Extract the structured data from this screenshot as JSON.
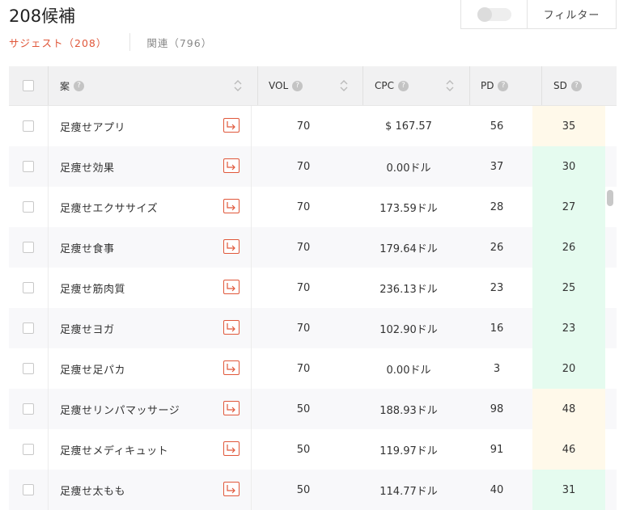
{
  "header": {
    "title": "208候補"
  },
  "tabs": {
    "suggest": "サジェスト（208）",
    "related": "関連（796）"
  },
  "filter": {
    "label": "フィルター"
  },
  "columns": {
    "keyword": "案",
    "vol": "VOL",
    "cpc": "CPC",
    "pd": "PD",
    "sd": "SD",
    "help": "?"
  },
  "colors": {
    "accent": "#e0573a",
    "sd_green": "#e5fbef",
    "sd_yellow": "#fff9ea"
  },
  "rows": [
    {
      "keyword": "足痩せアプリ",
      "vol": "70",
      "cpc": "$ 167.57",
      "pd": "56",
      "sd": "35",
      "sd_level": "yellow"
    },
    {
      "keyword": "足痩せ効果",
      "vol": "70",
      "cpc": "0.00ドル",
      "pd": "37",
      "sd": "30",
      "sd_level": "green"
    },
    {
      "keyword": "足痩せエクササイズ",
      "vol": "70",
      "cpc": "173.59ドル",
      "pd": "28",
      "sd": "27",
      "sd_level": "green"
    },
    {
      "keyword": "足痩せ食事",
      "vol": "70",
      "cpc": "179.64ドル",
      "pd": "26",
      "sd": "26",
      "sd_level": "green"
    },
    {
      "keyword": "足痩せ筋肉質",
      "vol": "70",
      "cpc": "236.13ドル",
      "pd": "23",
      "sd": "25",
      "sd_level": "green"
    },
    {
      "keyword": "足痩せヨガ",
      "vol": "70",
      "cpc": "102.90ドル",
      "pd": "16",
      "sd": "23",
      "sd_level": "green"
    },
    {
      "keyword": "足痩せ足パカ",
      "vol": "70",
      "cpc": "0.00ドル",
      "pd": "3",
      "sd": "20",
      "sd_level": "green"
    },
    {
      "keyword": "足痩せリンパマッサージ",
      "vol": "50",
      "cpc": "188.93ドル",
      "pd": "98",
      "sd": "48",
      "sd_level": "yellow"
    },
    {
      "keyword": "足痩せメディキュット",
      "vol": "50",
      "cpc": "119.97ドル",
      "pd": "91",
      "sd": "46",
      "sd_level": "yellow"
    },
    {
      "keyword": "足痩せ太もも",
      "vol": "50",
      "cpc": "114.77ドル",
      "pd": "40",
      "sd": "31",
      "sd_level": "green"
    }
  ]
}
